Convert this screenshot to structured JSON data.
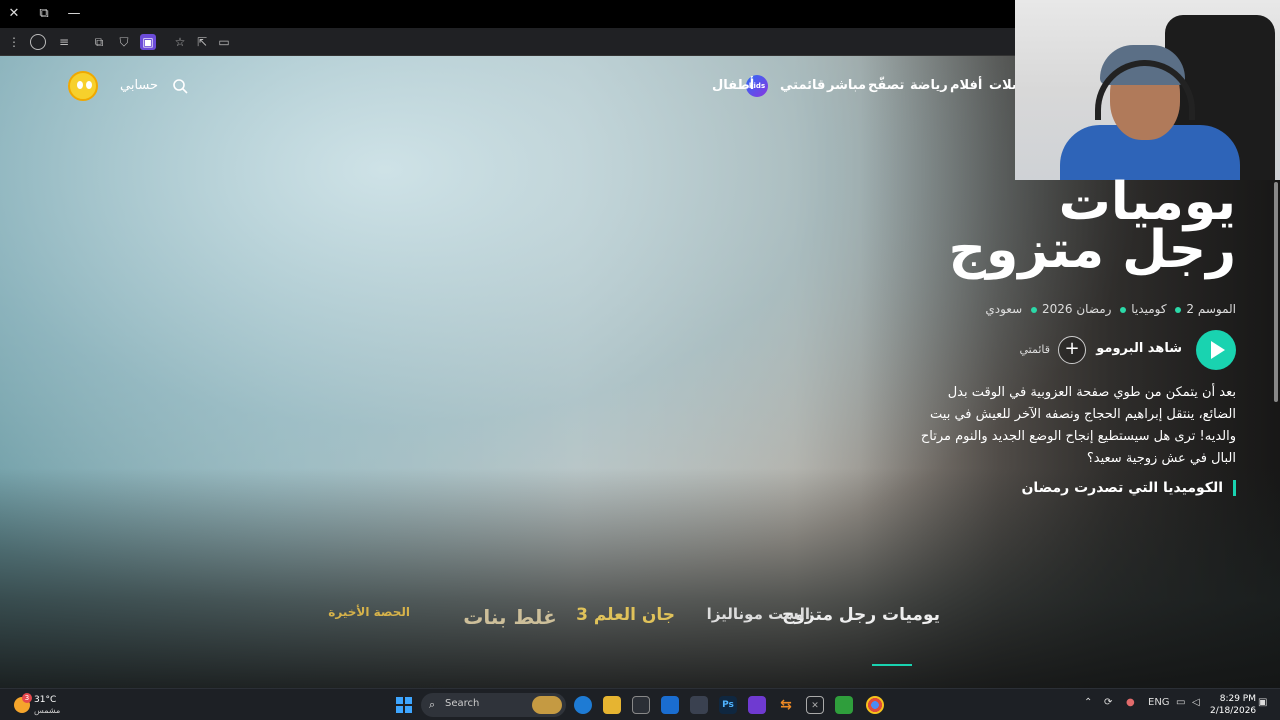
{
  "browser": {
    "close_glyph": "✕",
    "restore_glyph": "⧉",
    "minimize_glyph": "—"
  },
  "nav": {
    "items": [
      "سلات",
      "أفلام",
      "رياضة",
      "تصفّح",
      "مباشر",
      "قائمتي",
      "أطفال"
    ],
    "kids_badge": "kids",
    "account_label": "حسابي",
    "account_chevron": "⌄"
  },
  "show": {
    "title_line1": "يوميات",
    "title_line2": "رجل متزوج",
    "meta": [
      "الموسم 2",
      "كوميديا",
      "رمضان 2026",
      "سعودي"
    ],
    "promo_label": "شاهد البرومو",
    "add_glyph": "+",
    "mylist_label": "قائمتي",
    "description": "بعد أن يتمكن من طوي صفحة العزوبية في الوقت بدل الضائع، ينتقل إبراهيم الحجاج ونصفه الآخر للعيش في بيت والديه! ترى هل سيستطيع إنجاح الوضع الجديد والنوم مرتاح البال في عش زوجية سعيد؟",
    "tagline": "الكوميديا التي تصدرت رمضان",
    "accent_color": "#19d3b0"
  },
  "thumbnails": [
    {
      "label": "يوميات رجل متزوج",
      "active": true
    },
    {
      "label": "الست موناليزا",
      "active": false
    },
    {
      "label": "جان العلم 3",
      "active": false
    },
    {
      "label": "غلط بنات",
      "active": false
    },
    {
      "label": "الحصة الأخيرة",
      "active": false
    }
  ],
  "taskbar": {
    "weather_temp": "31°C",
    "weather_desc": "مشمس",
    "weather_badge": "3",
    "search_label": "Search",
    "lang": "ENG",
    "time": "8:29 PM",
    "date": "2/18/2026"
  }
}
